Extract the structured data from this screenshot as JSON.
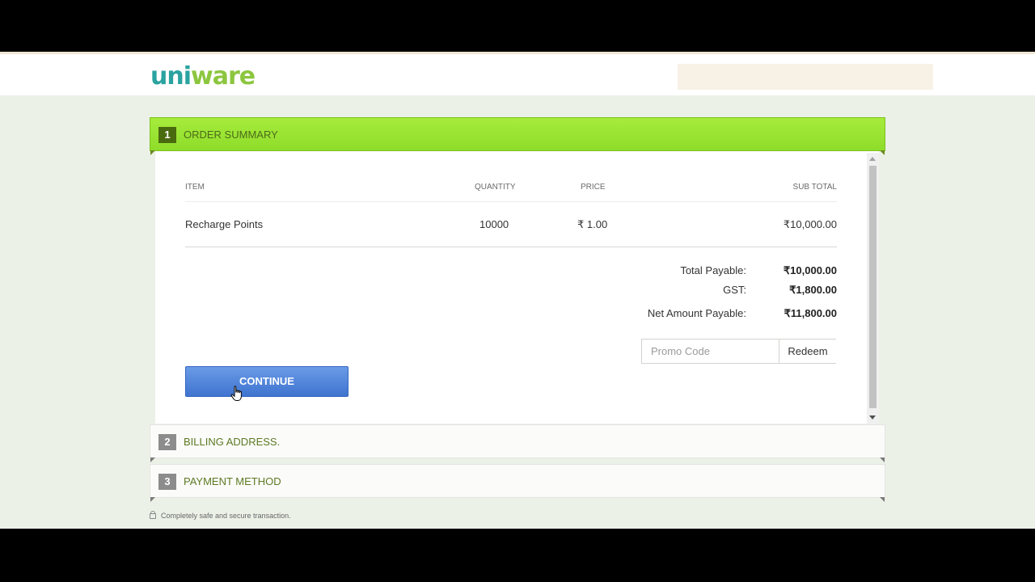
{
  "header": {
    "logo_part1": "uni",
    "logo_part2": "ware"
  },
  "steps": [
    {
      "number": "1",
      "title": "ORDER SUMMARY"
    },
    {
      "number": "2",
      "title": "BILLING ADDRESS."
    },
    {
      "number": "3",
      "title": "PAYMENT METHOD"
    }
  ],
  "order": {
    "columns": [
      "ITEM",
      "QUANTITY",
      "PRICE",
      "SUB TOTAL"
    ],
    "rows": [
      {
        "item": "Recharge Points",
        "quantity": "10000",
        "price": "₹ 1.00",
        "subtotal": "₹10,000.00"
      }
    ],
    "totals": [
      {
        "label": "Total Payable:",
        "value": "₹10,000.00"
      },
      {
        "label": "GST:",
        "value": "₹1,800.00"
      },
      {
        "label": "Net Amount Payable:",
        "value": "₹11,800.00"
      }
    ]
  },
  "promo": {
    "placeholder": "Promo Code",
    "redeem_label": "Redeem"
  },
  "continue_label": "CONTINUE",
  "footer": {
    "secure_text": "Completely safe and secure transaction."
  }
}
